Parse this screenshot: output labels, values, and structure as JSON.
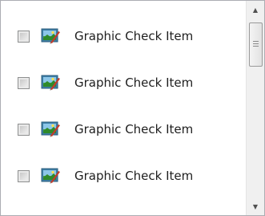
{
  "list": {
    "items": [
      {
        "label": "Graphic Check Item",
        "checked": false,
        "icon": "picture-icon"
      },
      {
        "label": "Graphic Check Item",
        "checked": false,
        "icon": "picture-icon"
      },
      {
        "label": "Graphic Check Item",
        "checked": false,
        "icon": "picture-icon"
      },
      {
        "label": "Graphic Check Item",
        "checked": false,
        "icon": "picture-icon"
      }
    ]
  },
  "scrollbar": {
    "up_icon": "scroll-up-arrow-icon",
    "down_icon": "scroll-down-arrow-icon",
    "thumb_grip_icon": "grip-icon"
  },
  "colors": {
    "border": "#abadb3",
    "text": "#1e1e1e",
    "scroll_track": "#f0f0f0"
  }
}
